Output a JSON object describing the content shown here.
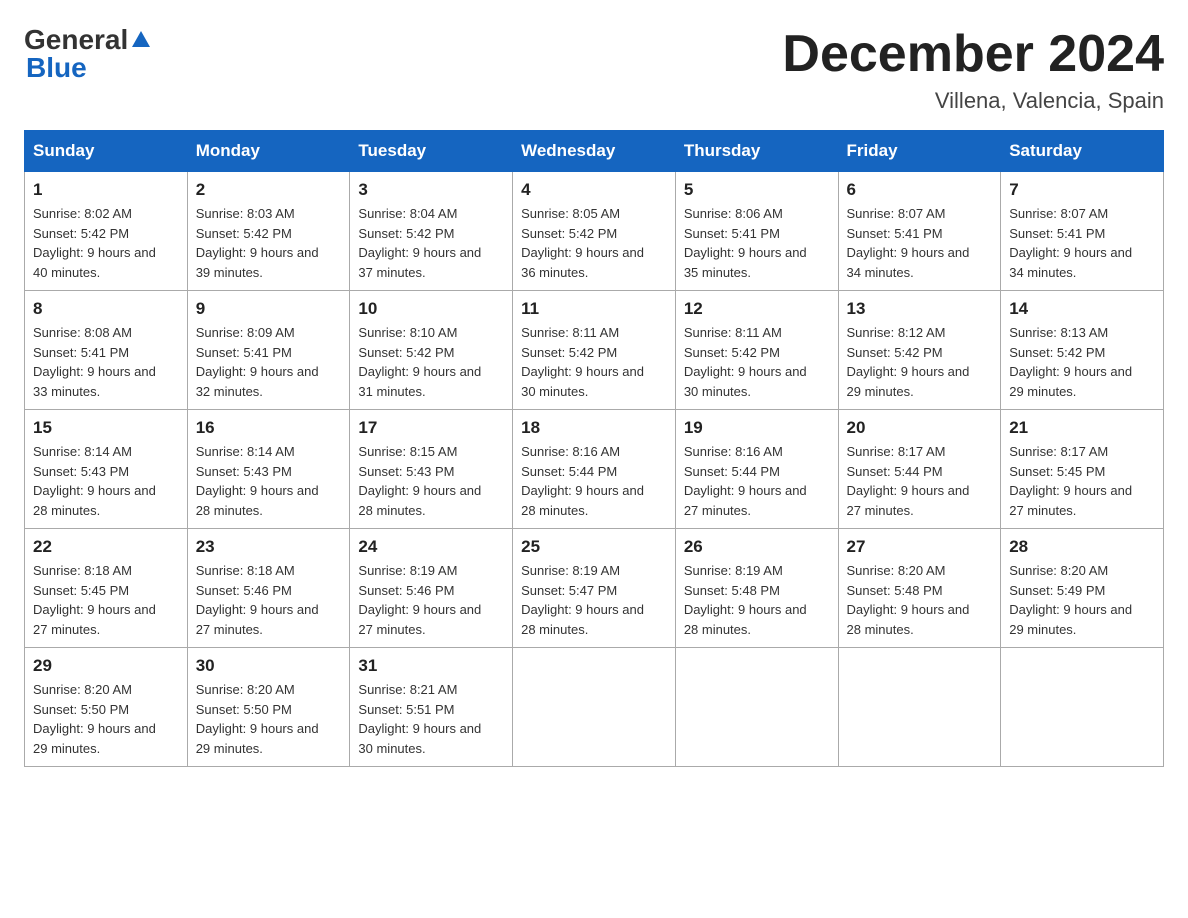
{
  "header": {
    "logo_general": "General",
    "logo_blue": "Blue",
    "month_title": "December 2024",
    "location": "Villena, Valencia, Spain"
  },
  "days_of_week": [
    "Sunday",
    "Monday",
    "Tuesday",
    "Wednesday",
    "Thursday",
    "Friday",
    "Saturday"
  ],
  "weeks": [
    [
      {
        "day": "1",
        "sunrise": "8:02 AM",
        "sunset": "5:42 PM",
        "daylight": "9 hours and 40 minutes."
      },
      {
        "day": "2",
        "sunrise": "8:03 AM",
        "sunset": "5:42 PM",
        "daylight": "9 hours and 39 minutes."
      },
      {
        "day": "3",
        "sunrise": "8:04 AM",
        "sunset": "5:42 PM",
        "daylight": "9 hours and 37 minutes."
      },
      {
        "day": "4",
        "sunrise": "8:05 AM",
        "sunset": "5:42 PM",
        "daylight": "9 hours and 36 minutes."
      },
      {
        "day": "5",
        "sunrise": "8:06 AM",
        "sunset": "5:41 PM",
        "daylight": "9 hours and 35 minutes."
      },
      {
        "day": "6",
        "sunrise": "8:07 AM",
        "sunset": "5:41 PM",
        "daylight": "9 hours and 34 minutes."
      },
      {
        "day": "7",
        "sunrise": "8:07 AM",
        "sunset": "5:41 PM",
        "daylight": "9 hours and 34 minutes."
      }
    ],
    [
      {
        "day": "8",
        "sunrise": "8:08 AM",
        "sunset": "5:41 PM",
        "daylight": "9 hours and 33 minutes."
      },
      {
        "day": "9",
        "sunrise": "8:09 AM",
        "sunset": "5:41 PM",
        "daylight": "9 hours and 32 minutes."
      },
      {
        "day": "10",
        "sunrise": "8:10 AM",
        "sunset": "5:42 PM",
        "daylight": "9 hours and 31 minutes."
      },
      {
        "day": "11",
        "sunrise": "8:11 AM",
        "sunset": "5:42 PM",
        "daylight": "9 hours and 30 minutes."
      },
      {
        "day": "12",
        "sunrise": "8:11 AM",
        "sunset": "5:42 PM",
        "daylight": "9 hours and 30 minutes."
      },
      {
        "day": "13",
        "sunrise": "8:12 AM",
        "sunset": "5:42 PM",
        "daylight": "9 hours and 29 minutes."
      },
      {
        "day": "14",
        "sunrise": "8:13 AM",
        "sunset": "5:42 PM",
        "daylight": "9 hours and 29 minutes."
      }
    ],
    [
      {
        "day": "15",
        "sunrise": "8:14 AM",
        "sunset": "5:43 PM",
        "daylight": "9 hours and 28 minutes."
      },
      {
        "day": "16",
        "sunrise": "8:14 AM",
        "sunset": "5:43 PM",
        "daylight": "9 hours and 28 minutes."
      },
      {
        "day": "17",
        "sunrise": "8:15 AM",
        "sunset": "5:43 PM",
        "daylight": "9 hours and 28 minutes."
      },
      {
        "day": "18",
        "sunrise": "8:16 AM",
        "sunset": "5:44 PM",
        "daylight": "9 hours and 28 minutes."
      },
      {
        "day": "19",
        "sunrise": "8:16 AM",
        "sunset": "5:44 PM",
        "daylight": "9 hours and 27 minutes."
      },
      {
        "day": "20",
        "sunrise": "8:17 AM",
        "sunset": "5:44 PM",
        "daylight": "9 hours and 27 minutes."
      },
      {
        "day": "21",
        "sunrise": "8:17 AM",
        "sunset": "5:45 PM",
        "daylight": "9 hours and 27 minutes."
      }
    ],
    [
      {
        "day": "22",
        "sunrise": "8:18 AM",
        "sunset": "5:45 PM",
        "daylight": "9 hours and 27 minutes."
      },
      {
        "day": "23",
        "sunrise": "8:18 AM",
        "sunset": "5:46 PM",
        "daylight": "9 hours and 27 minutes."
      },
      {
        "day": "24",
        "sunrise": "8:19 AM",
        "sunset": "5:46 PM",
        "daylight": "9 hours and 27 minutes."
      },
      {
        "day": "25",
        "sunrise": "8:19 AM",
        "sunset": "5:47 PM",
        "daylight": "9 hours and 28 minutes."
      },
      {
        "day": "26",
        "sunrise": "8:19 AM",
        "sunset": "5:48 PM",
        "daylight": "9 hours and 28 minutes."
      },
      {
        "day": "27",
        "sunrise": "8:20 AM",
        "sunset": "5:48 PM",
        "daylight": "9 hours and 28 minutes."
      },
      {
        "day": "28",
        "sunrise": "8:20 AM",
        "sunset": "5:49 PM",
        "daylight": "9 hours and 29 minutes."
      }
    ],
    [
      {
        "day": "29",
        "sunrise": "8:20 AM",
        "sunset": "5:50 PM",
        "daylight": "9 hours and 29 minutes."
      },
      {
        "day": "30",
        "sunrise": "8:20 AM",
        "sunset": "5:50 PM",
        "daylight": "9 hours and 29 minutes."
      },
      {
        "day": "31",
        "sunrise": "8:21 AM",
        "sunset": "5:51 PM",
        "daylight": "9 hours and 30 minutes."
      },
      null,
      null,
      null,
      null
    ]
  ]
}
